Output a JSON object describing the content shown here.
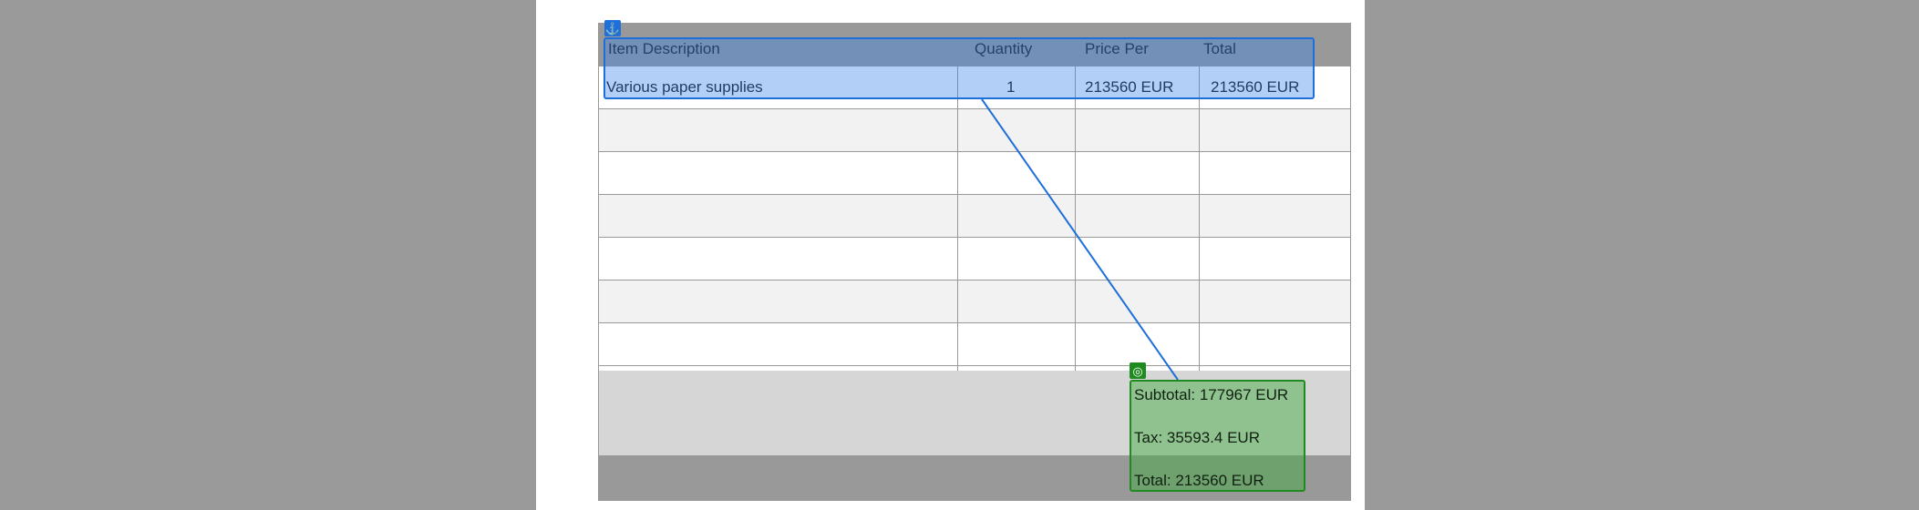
{
  "table": {
    "headers": {
      "description": "Item Description",
      "quantity": "Quantity",
      "price_per": "Price Per",
      "total": "Total"
    },
    "rows": [
      {
        "description": "Various paper supplies",
        "quantity": "1",
        "price_per": "213560 EUR",
        "total": "213560 EUR"
      }
    ],
    "empty_row_count": 6
  },
  "summary": {
    "subtotal": "Subtotal: 177967 EUR",
    "tax": "Tax: 35593.4 EUR",
    "total": "Total: 213560 EUR"
  },
  "overlay": {
    "anchor_icon": "anchor-icon",
    "target_icon": "target-icon",
    "anchor_color": "#1e6fd9",
    "target_color": "#1f8a1f",
    "link_color": "#1e6fd9"
  }
}
